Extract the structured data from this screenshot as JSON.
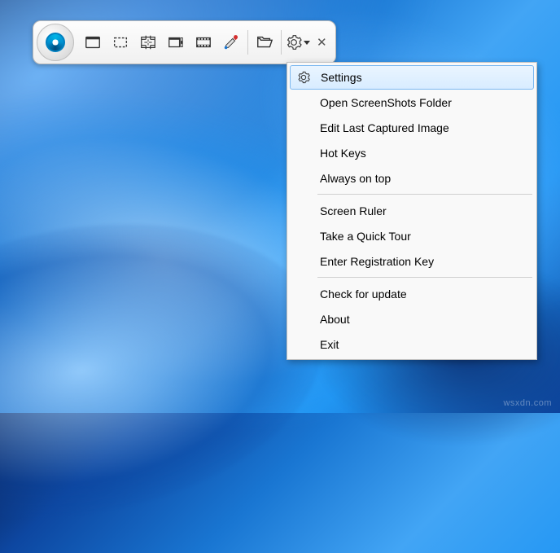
{
  "toolbar": {
    "icons": [
      "fullscreen-capture-icon",
      "region-capture-icon",
      "active-window-capture-icon",
      "scrolling-capture-icon",
      "video-capture-icon",
      "color-picker-icon",
      "open-folder-icon"
    ]
  },
  "menu": {
    "items": [
      {
        "label": "Settings",
        "icon": "gear-icon",
        "highlighted": true
      },
      {
        "label": "Open ScreenShots Folder"
      },
      {
        "label": "Edit Last Captured Image"
      },
      {
        "label": "Hot Keys"
      },
      {
        "label": "Always on top"
      }
    ],
    "group2": [
      {
        "label": "Screen Ruler"
      },
      {
        "label": "Take a Quick Tour"
      },
      {
        "label": "Enter Registration Key"
      }
    ],
    "group3": [
      {
        "label": "Check for update"
      },
      {
        "label": "About"
      },
      {
        "label": "Exit"
      }
    ]
  },
  "watermark": "wsxdn.com"
}
